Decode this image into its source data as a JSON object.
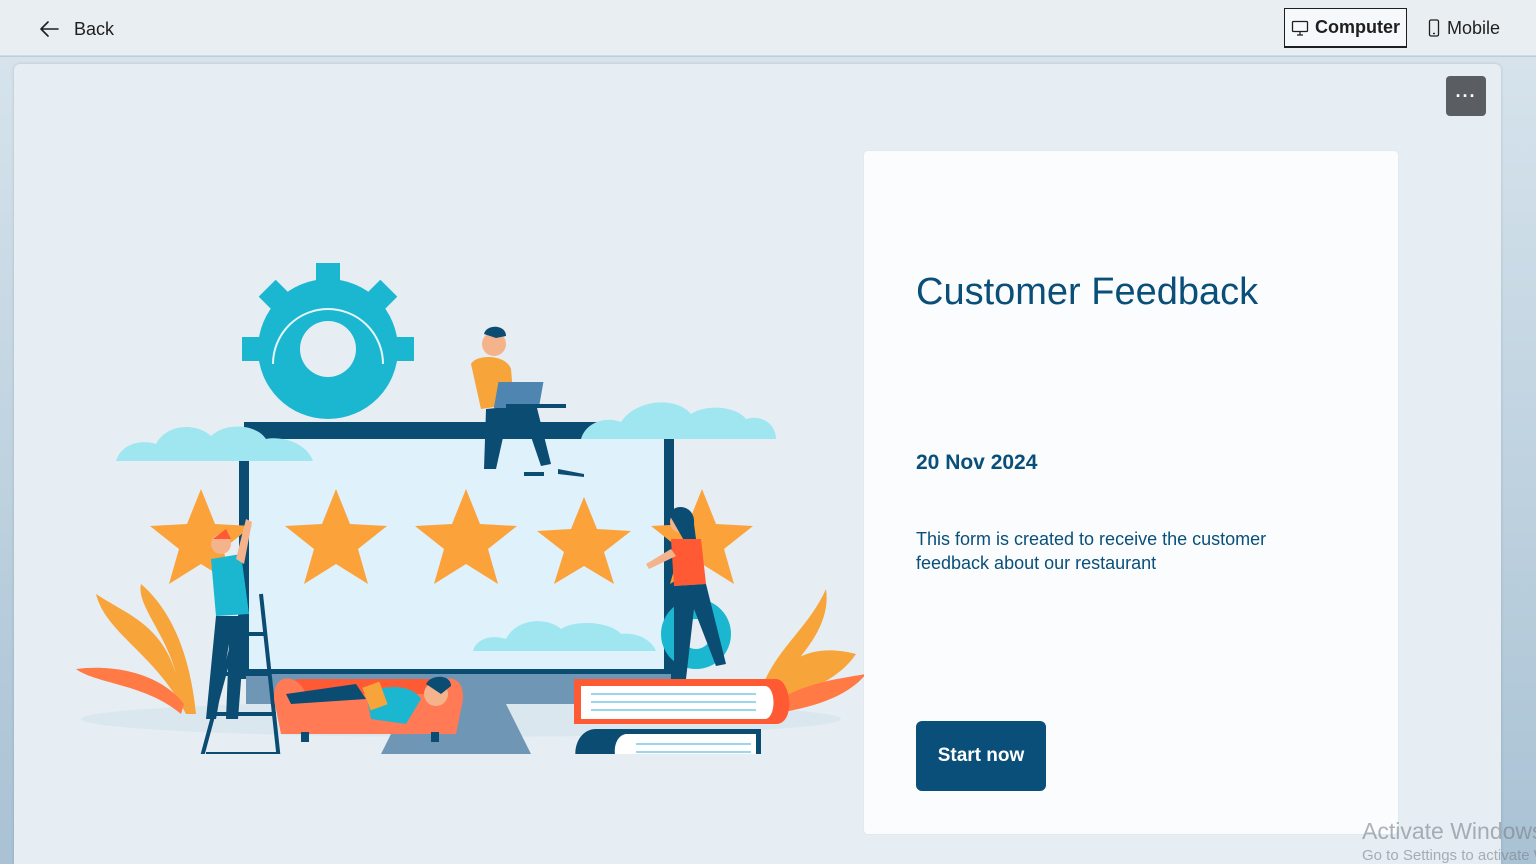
{
  "header": {
    "back_label": "Back",
    "view_options": [
      {
        "label": "Computer",
        "icon": "monitor-icon",
        "active": true
      },
      {
        "label": "Mobile",
        "icon": "phone-icon",
        "active": false
      }
    ]
  },
  "canvas": {
    "more_label": "···"
  },
  "card": {
    "title": "Customer Feedback",
    "date": "20 Nov 2024",
    "description": "This form is created to receive the customer feedback about our restaurant",
    "start_label": "Start now"
  },
  "watermark": {
    "line1": "Activate Windows",
    "line2": "Go to Settings to activate Windows."
  },
  "colors": {
    "accent": "#0a4f79",
    "star": "#fba23a",
    "gear": "#1bb7d1",
    "cloud": "#9fe6f1",
    "coral": "#ff5a33"
  }
}
